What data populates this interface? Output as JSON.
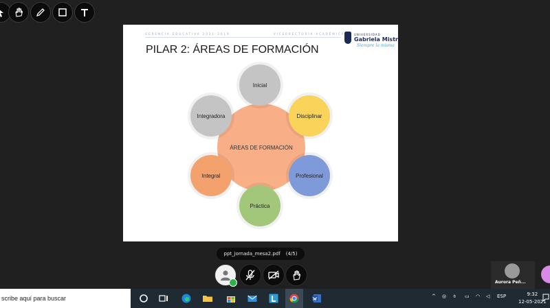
{
  "toolbar": {
    "tools": [
      "cursor-icon",
      "hand-icon",
      "pen-icon",
      "rectangle-icon",
      "text-icon"
    ]
  },
  "slide": {
    "header_left": "GERENCIA EDUCATIVA 2021-2019",
    "header_right": "VICERRECTORÍA ACADÉMICA",
    "logo_small": "UNIVERSIDAD",
    "logo_name": "Gabriela Mistral",
    "logo_tagline": "Siempre la misma",
    "title": "PILAR 2: ÁREAS DE FORMACIÓN",
    "center_label": "ÁREAS DE FORMACIÓN",
    "areas": {
      "inicial": "Inicial",
      "disciplinar": "Disciplinar",
      "profesional": "Profesional",
      "practica": "Práctica",
      "integral": "Integral",
      "integradora": "Integradora"
    }
  },
  "share": {
    "file_name": "ppt_jornada_mesa2.pdf",
    "page_indicator": "(4/5)"
  },
  "participant": {
    "name": "Aurora Peñ..."
  },
  "taskbar": {
    "search_placeholder": "scribe aquí para buscar",
    "language": "ESP",
    "time": "9:32",
    "date": "12-05-2021"
  },
  "colors": {
    "center": "#f8a97d",
    "inicial": "#c4c4c4",
    "disciplinar": "#f9d35a",
    "profesional": "#7f9ad8",
    "practica": "#a3c77a",
    "integral": "#f3a26e",
    "integradora": "#c4c4c4"
  }
}
